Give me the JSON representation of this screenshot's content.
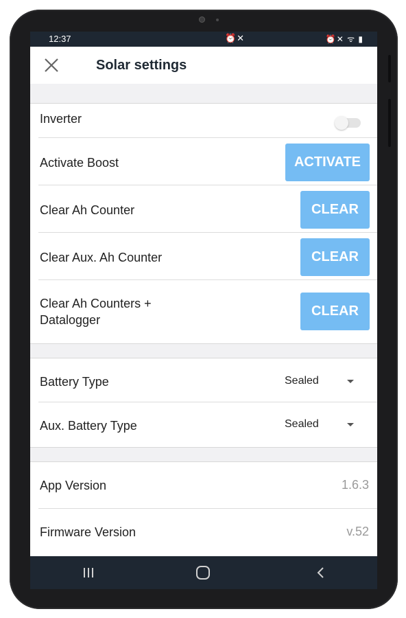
{
  "status_bar": {
    "time": "12:37",
    "icons_center": "⏰✕",
    "icons_right": "⏰✕ ᯤ ▮"
  },
  "app_bar": {
    "title": "Solar settings",
    "close_icon": "close-icon"
  },
  "rows": {
    "inverter": {
      "label": "Inverter",
      "toggle_on": false
    },
    "activate_boost": {
      "label": "Activate Boost",
      "button": "ACTIVATE"
    },
    "clear_ah": {
      "label": "Clear Ah Counter",
      "button": "CLEAR"
    },
    "clear_aux_ah": {
      "label": "Clear Aux. Ah Counter",
      "button": "CLEAR"
    },
    "clear_all": {
      "label_line1": "Clear Ah Counters +",
      "label_line2": "Datalogger",
      "button": "CLEAR"
    },
    "battery_type": {
      "label": "Battery Type",
      "value": "Sealed"
    },
    "aux_battery_type": {
      "label": "Aux. Battery Type",
      "value": "Sealed"
    },
    "app_version": {
      "label": "App Version",
      "value": "1.6.3"
    },
    "firmware_version": {
      "label": "Firmware Version",
      "value": "v.52"
    }
  },
  "nav_bar": {
    "recents_icon": "recents-icon",
    "home_icon": "home-icon",
    "back_icon": "back-icon"
  },
  "colors": {
    "accent_button": "#75bcf3",
    "system_bar": "#1e2732",
    "section_gap": "#f1f1f3"
  }
}
